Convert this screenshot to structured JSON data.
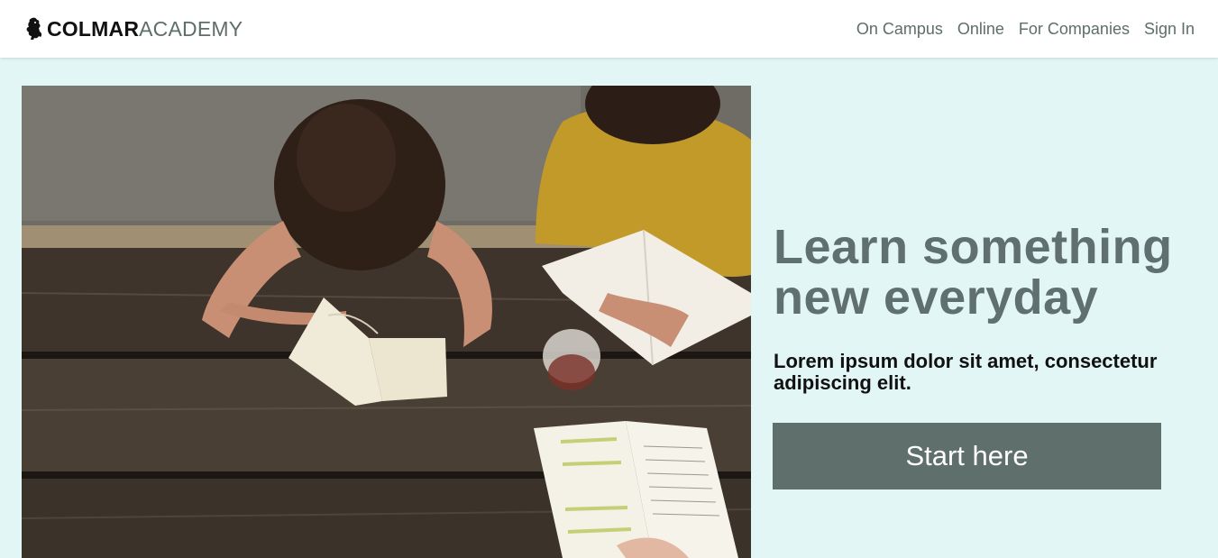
{
  "nav": {
    "brand_bold": "COLMAR",
    "brand_light": "ACADEMY",
    "brand_icon": "lion-icon",
    "links": [
      {
        "label": "On Campus"
      },
      {
        "label": "Online"
      },
      {
        "label": "For Companies"
      },
      {
        "label": "Sign In"
      }
    ]
  },
  "hero": {
    "image_alt": "hero-photo",
    "headline": "Learn something new everyday",
    "subline": "Lorem ipsum dolor sit amet, consectetur adipiscing elit.",
    "cta_label": "Start here"
  },
  "colors": {
    "background": "#e2f6f5",
    "headline": "#5f706f",
    "cta": "#5f706c",
    "nav_link": "#5e6e6c"
  }
}
